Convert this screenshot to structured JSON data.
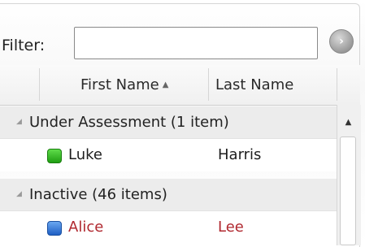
{
  "filter": {
    "label": "Filter:",
    "value": "",
    "placeholder": ""
  },
  "columns": [
    {
      "label": "First Name",
      "sort": "ascending"
    },
    {
      "label": "Last Name"
    }
  ],
  "groups": [
    {
      "label": "Under Assessment (1 item)",
      "rows": [
        {
          "first": "Luke",
          "last": "Harris",
          "status_icon": "green-status-icon",
          "text_color": "#1e1e1e"
        }
      ]
    },
    {
      "label": "Inactive (46 items)",
      "rows": [
        {
          "first": "Alice",
          "last": "Lee",
          "status_icon": "blue-status-icon",
          "text_color": "#b0282f"
        }
      ]
    }
  ],
  "colors": {
    "inactive_text": "#b0282f",
    "group_bg": "#ececec"
  }
}
